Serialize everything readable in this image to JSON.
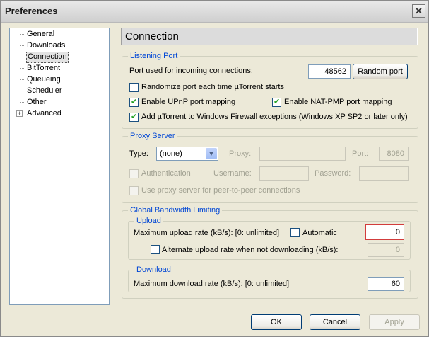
{
  "window": {
    "title": "Preferences"
  },
  "tree": {
    "items": [
      {
        "label": "General"
      },
      {
        "label": "Downloads"
      },
      {
        "label": "Connection"
      },
      {
        "label": "BitTorrent"
      },
      {
        "label": "Queueing"
      },
      {
        "label": "Scheduler"
      },
      {
        "label": "Other"
      },
      {
        "label": "Advanced"
      }
    ],
    "selected": "Connection"
  },
  "header": {
    "title": "Connection"
  },
  "listening_port": {
    "legend": "Listening Port",
    "port_label": "Port used for incoming connections:",
    "port_value": "48562",
    "random_port_button": "Random port",
    "randomize_label": "Randomize port each time µTorrent starts",
    "randomize_checked": false,
    "upnp_label": "Enable UPnP port mapping",
    "upnp_checked": true,
    "natpmp_label": "Enable NAT-PMP port mapping",
    "natpmp_checked": true,
    "firewall_label": "Add µTorrent to Windows Firewall exceptions (Windows XP SP2 or later only)",
    "firewall_checked": true
  },
  "proxy": {
    "legend": "Proxy Server",
    "type_label": "Type:",
    "type_value": "(none)",
    "proxy_label": "Proxy:",
    "proxy_value": "",
    "port_label": "Port:",
    "port_value": "8080",
    "auth_label": "Authentication",
    "username_label": "Username:",
    "password_label": "Password:",
    "p2p_label": "Use proxy server for peer-to-peer connections"
  },
  "bandwidth": {
    "legend": "Global Bandwidth Limiting",
    "upload": {
      "legend": "Upload",
      "max_label": "Maximum upload rate (kB/s): [0: unlimited]",
      "automatic_label": "Automatic",
      "max_value": "0",
      "alternate_label": "Alternate upload rate when not downloading (kB/s):",
      "alternate_value": "0"
    },
    "download": {
      "legend": "Download",
      "max_label": "Maximum download rate (kB/s): [0: unlimited]",
      "max_value": "60"
    }
  },
  "buttons": {
    "ok": "OK",
    "cancel": "Cancel",
    "apply": "Apply"
  }
}
